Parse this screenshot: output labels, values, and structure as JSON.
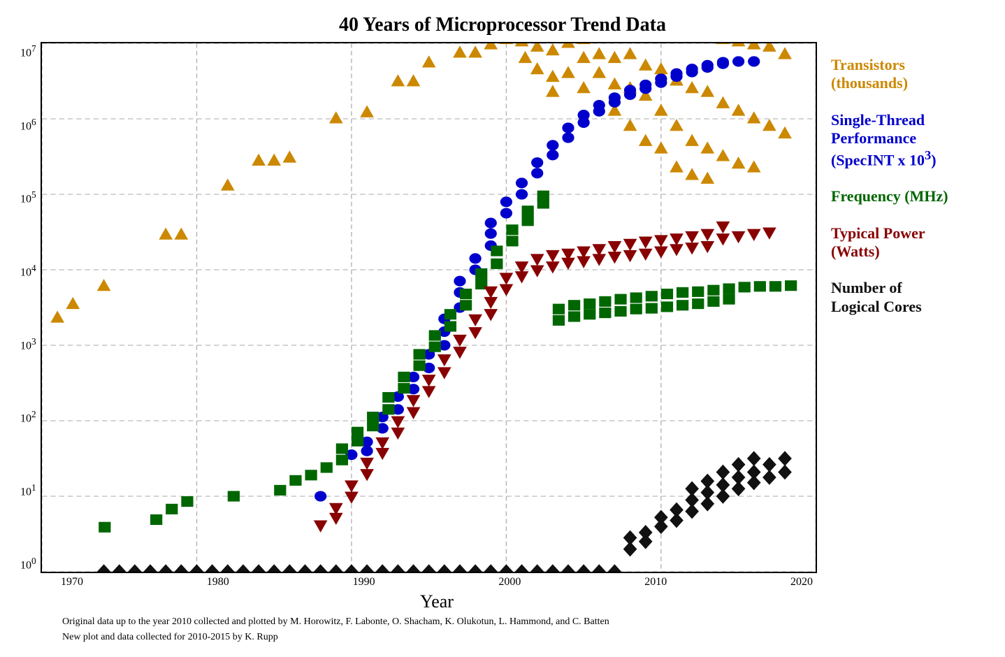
{
  "title": "40 Years of Microprocessor Trend Data",
  "xaxis": {
    "label": "Year",
    "ticks": [
      "1970",
      "1980",
      "1990",
      "2000",
      "2010",
      "2020"
    ]
  },
  "yaxis": {
    "ticks": [
      "10⁷",
      "10⁶",
      "10⁵",
      "10⁴",
      "10³",
      "10²",
      "10¹",
      "10⁰"
    ]
  },
  "legend": [
    {
      "label": "Transistors\n(thousands)",
      "color": "#CC8800",
      "shape": "triangle-up"
    },
    {
      "label": "Single-Thread\nPerformance\n(SpecINT x 10³)",
      "color": "#0000CC",
      "shape": "circle"
    },
    {
      "label": "Frequency (MHz)",
      "color": "#006600",
      "shape": "square"
    },
    {
      "label": "Typical Power\n(Watts)",
      "color": "#880000",
      "shape": "triangle-down"
    },
    {
      "label": "Number of\nLogical Cores",
      "color": "#000000",
      "shape": "diamond"
    }
  ],
  "footnote1": "Original data up to the year 2010 collected and plotted by M. Horowitz, F. Labonte, O. Shacham, K. Olukotun, L. Hammond, and C. Batten",
  "footnote2": "New plot and data collected for 2010-2015 by K. Rupp",
  "colors": {
    "transistors": "#CC8800",
    "performance": "#0000CC",
    "frequency": "#006600",
    "power": "#880000",
    "cores": "#111111"
  }
}
